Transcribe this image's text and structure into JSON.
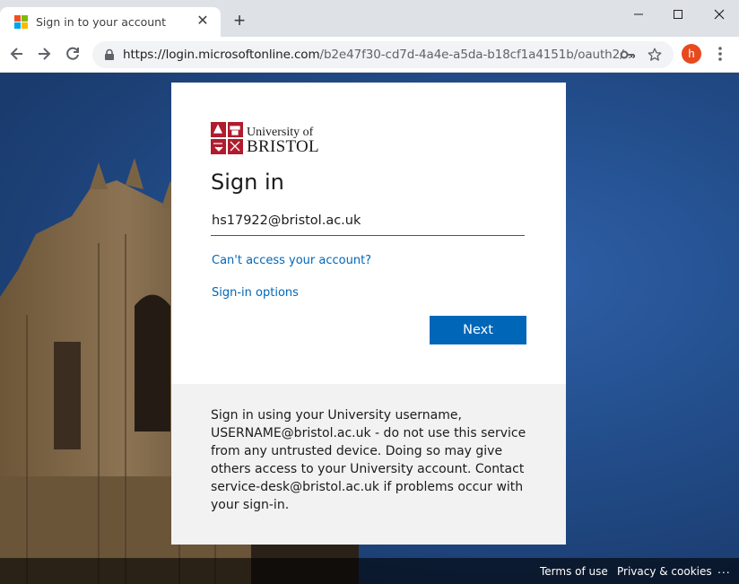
{
  "browser": {
    "tab_title": "Sign in to your account",
    "tab_close_icon": "close-icon",
    "new_tab_icon": "plus-icon",
    "url_host": "https://login.microsoftonline.com",
    "url_path": "/b2e47f30-cd7d-4a4e-a5da-b18cf1a4151b/oauth2/...",
    "profile_initial": "h",
    "profile_color": "#e8491d",
    "icons": [
      "back-icon",
      "forward-icon",
      "reload-icon",
      "lock-icon",
      "key-icon",
      "star-icon",
      "menu-icon",
      "minimize-icon",
      "maximize-icon",
      "window-close-icon"
    ]
  },
  "card": {
    "logo_line1": "University of",
    "logo_line2": "BRISTOL",
    "title": "Sign in",
    "email_value": "hs17922@bristol.ac.uk",
    "cant_access_link": "Can't access your account?",
    "signin_options_link": "Sign-in options",
    "next_button": "Next",
    "accent_color": "#0067b8"
  },
  "notice": {
    "text": "Sign in using your University username, USERNAME@bristol.ac.uk - do not use this service from any untrusted device. Doing so may give others access to your University account. Contact service-desk@bristol.ac.uk if problems occur with your sign-in."
  },
  "footer": {
    "terms": "Terms of use",
    "privacy": "Privacy & cookies",
    "more": "..."
  }
}
